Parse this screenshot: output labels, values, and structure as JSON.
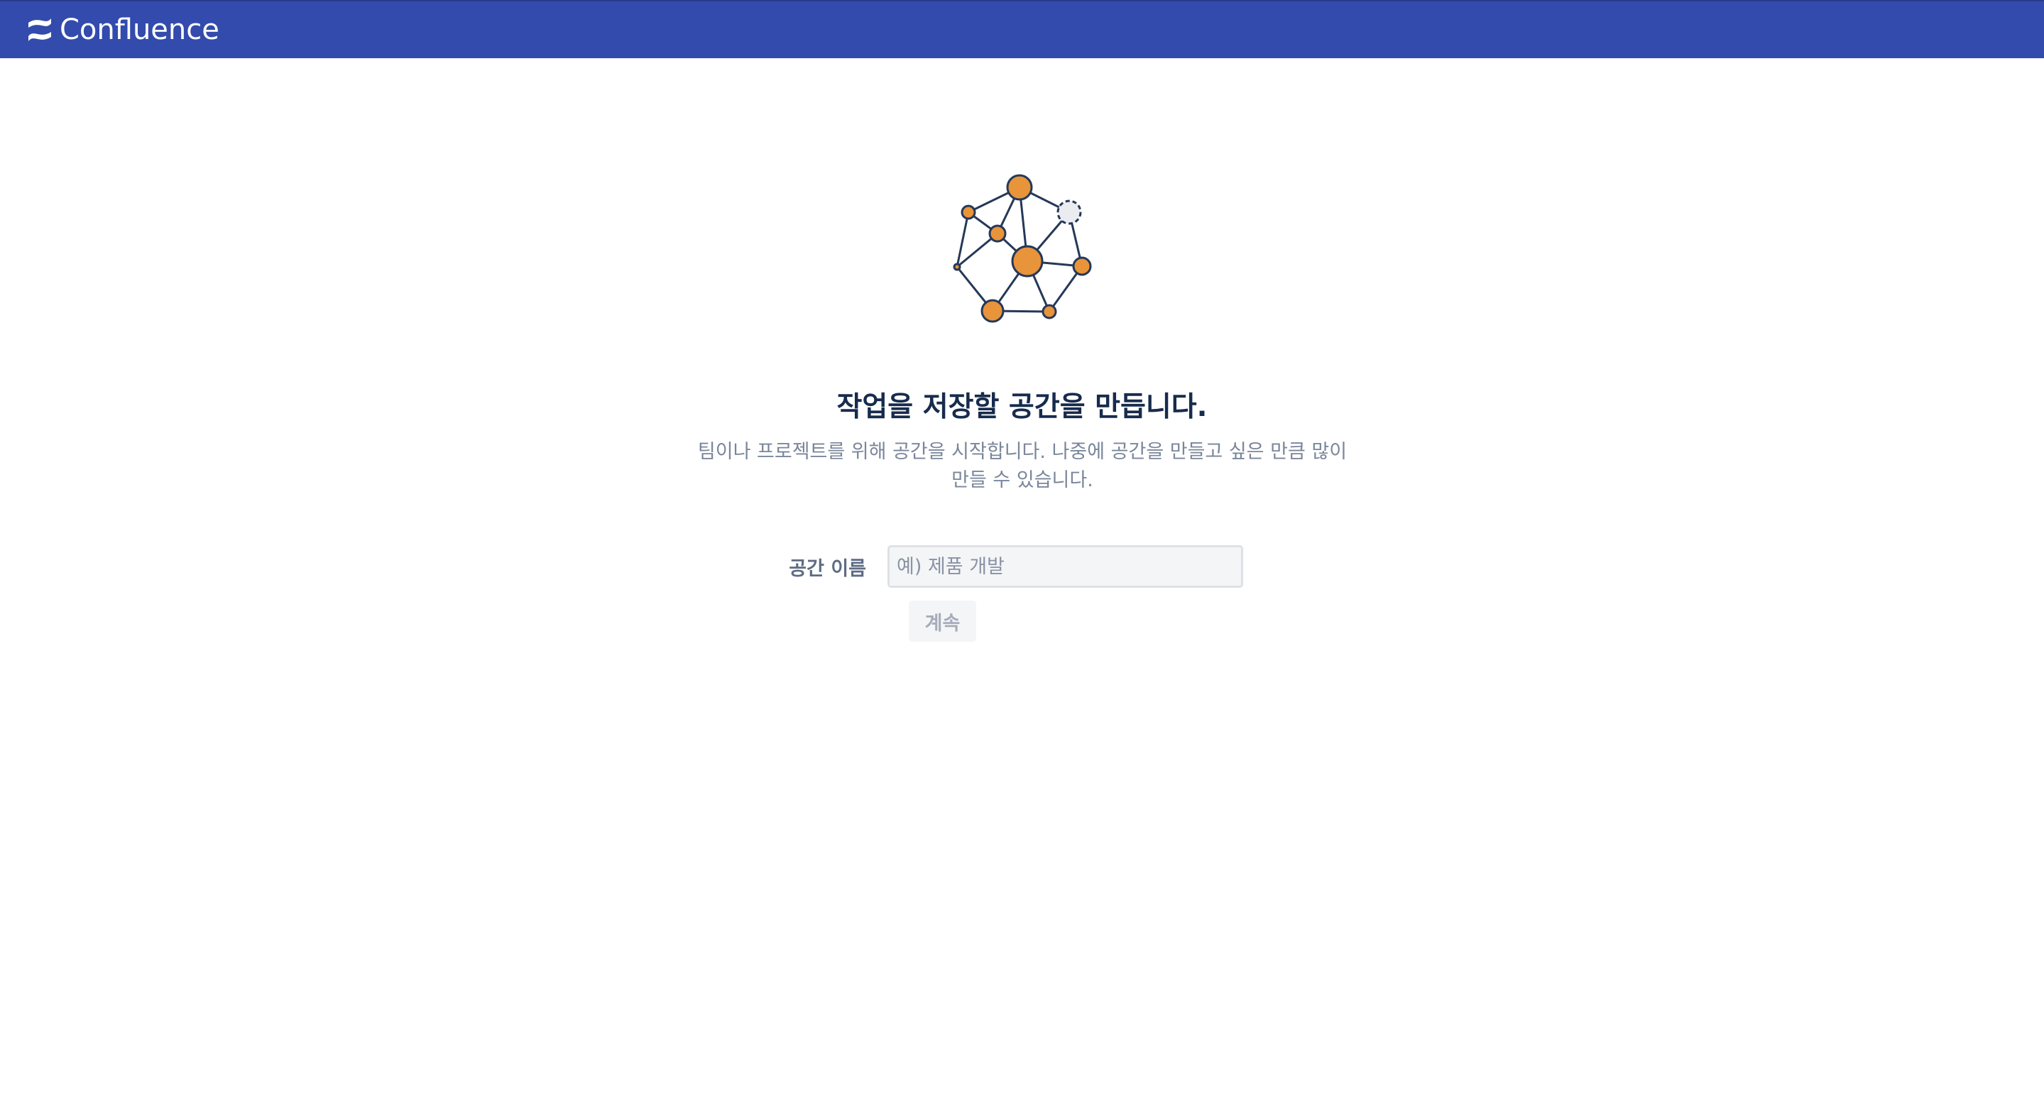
{
  "header": {
    "product_name": "Confluence",
    "logo_icon": "confluence-logo-icon",
    "background_color": "#334bac"
  },
  "main": {
    "illustration_icon": "network-nodes-icon",
    "headline": "작업을 저장할 공간을 만듭니다.",
    "description": "팀이나 프로젝트를 위해 공간을 시작합니다. 나중에 공간을 만들고 싶은 만큼 많이 만들 수 있습니다.",
    "space_name_label": "공간 이름",
    "space_name_placeholder": "예) 제품 개발",
    "space_name_value": "",
    "continue_label": "계속"
  },
  "colors": {
    "accent_orange": "#e8943a",
    "line_navy": "#253858",
    "headline": "#172b4d",
    "muted_text": "#7a869a"
  }
}
